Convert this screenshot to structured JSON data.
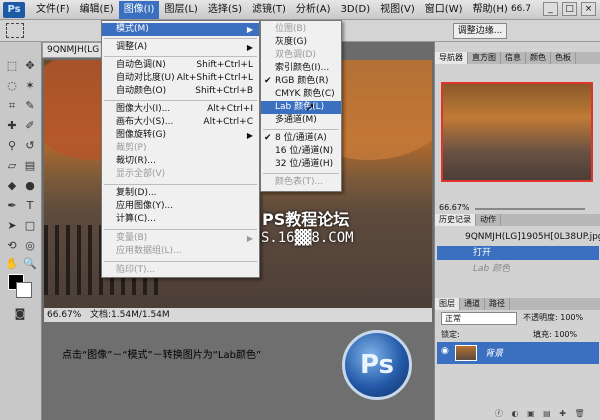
{
  "menubar": {
    "logo": "Ps",
    "items": [
      "文件(F)",
      "编辑(E)",
      "图像(I)",
      "图层(L)",
      "选择(S)",
      "滤镜(T)",
      "分析(A)",
      "3D(D)",
      "视图(V)",
      "窗口(W)",
      "帮助(H)"
    ],
    "zoom": "66.7"
  },
  "options": {
    "adjust_button": "调整边缘..."
  },
  "document": {
    "tab": "9QNMJH(LG",
    "zoom": "66.67%",
    "docinfo": "文档:1.54M/1.54M",
    "watermark_line1": "PS教程论坛",
    "watermark_line2": "BBS.16▓▓8.COM"
  },
  "image_menu": {
    "items": [
      {
        "label": "模式(M)",
        "arrow": "▶"
      },
      {
        "label": "调整(A)",
        "arrow": "▶"
      },
      {
        "label": "自动色调(N)",
        "shortcut": "Shift+Ctrl+L"
      },
      {
        "label": "自动对比度(U)",
        "shortcut": "Alt+Shift+Ctrl+L"
      },
      {
        "label": "自动颜色(O)",
        "shortcut": "Shift+Ctrl+B"
      },
      {
        "label": "图像大小(I)...",
        "shortcut": "Alt+Ctrl+I"
      },
      {
        "label": "画布大小(S)...",
        "shortcut": "Alt+Ctrl+C"
      },
      {
        "label": "图像旋转(G)",
        "arrow": "▶"
      },
      {
        "label": "裁剪(P)"
      },
      {
        "label": "裁切(R)..."
      },
      {
        "label": "显示全部(V)"
      },
      {
        "label": "复制(D)..."
      },
      {
        "label": "应用图像(Y)..."
      },
      {
        "label": "计算(C)..."
      },
      {
        "label": "变量(B)",
        "arrow": "▶"
      },
      {
        "label": "应用数据组(L)..."
      },
      {
        "label": "陷印(T)..."
      }
    ]
  },
  "mode_submenu": {
    "items": [
      "位图(B)",
      "灰度(G)",
      "双色调(D)",
      "索引颜色(I)...",
      "RGB 颜色(R)",
      "CMYK 颜色(C)",
      "Lab 颜色(L)",
      "多通道(M)",
      "8 位/通道(A)",
      "16 位/通道(N)",
      "32 位/通道(H)",
      "颜色表(T)..."
    ],
    "check": "✔"
  },
  "panels": {
    "nav_tabs": [
      "导航器",
      "直方图",
      "信息",
      "颜色",
      "色板"
    ],
    "nav_zoom": "66.67%",
    "history_tabs": [
      "历史记录",
      "动作"
    ],
    "history": {
      "snapshot": "9QNMJH(LG]1905H[0L38UP.jpg",
      "open": "打开",
      "lab": "Lab 颜色"
    },
    "layer_tabs": [
      "图层",
      "通道",
      "路径"
    ],
    "blend_mode": "正常",
    "opacity_label": "不透明度:",
    "opacity_value": "100%",
    "lock_label": "锁定:",
    "fill_label": "填充:",
    "fill_value": "100%",
    "layer_name": "背景"
  },
  "caption": "点击“图像”－“模式”－转换图片为“Lab颜色”",
  "ps_logo_text": "Ps"
}
